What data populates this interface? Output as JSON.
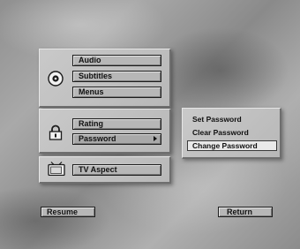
{
  "menu": {
    "groups": [
      {
        "icon": "dvd-disc-icon",
        "items": [
          "Audio",
          "Subtitles",
          "Menus"
        ]
      },
      {
        "icon": "padlock-icon",
        "items": [
          "Rating",
          "Password"
        ]
      },
      {
        "icon": "tv-icon",
        "items": [
          "TV Aspect"
        ]
      }
    ],
    "submenu": {
      "items": [
        "Set Password",
        "Clear Password",
        "Change Password"
      ],
      "selected": "Change Password"
    }
  },
  "footer": {
    "resume_label": "Resume",
    "return_label": "Return"
  }
}
